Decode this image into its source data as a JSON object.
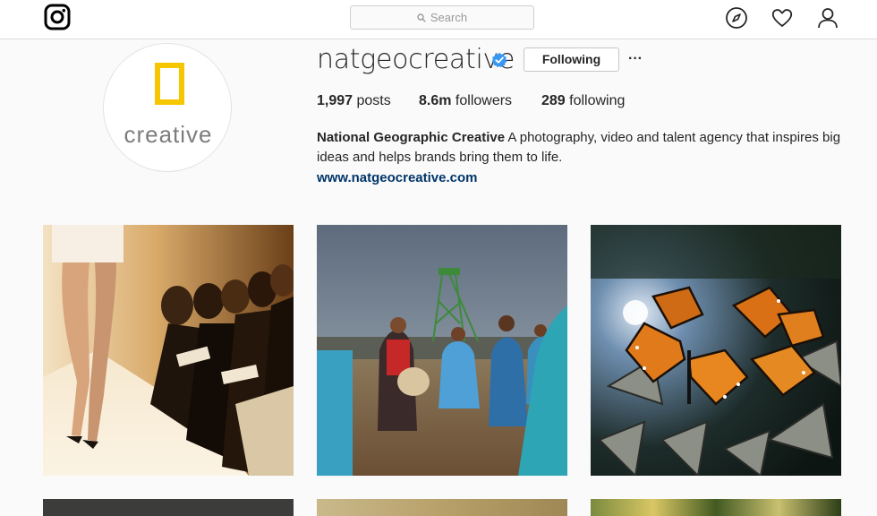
{
  "search": {
    "placeholder": "Search"
  },
  "profile": {
    "username": "natgeocreative",
    "verified": true,
    "follow_button": "Following",
    "more_label": "···",
    "avatar_text": "creative",
    "stats": {
      "posts_count": "1,997",
      "posts_label": " posts",
      "followers_count": "8.6m",
      "followers_label": " followers",
      "following_count": "289",
      "following_label": " following"
    },
    "bio_name": "National Geographic Creative",
    "bio_text": " A photography, video and talent agency that inspires big ideas and helps brands bring them to life.",
    "website": "www.natgeocreative.com"
  },
  "colors": {
    "brand_yellow": "#f6c600",
    "verified_blue": "#3897f0",
    "link_navy": "#003569"
  },
  "icons": [
    "instagram-logo-icon",
    "search-icon",
    "explore-compass-icon",
    "heart-icon",
    "profile-person-icon",
    "verified-badge-icon"
  ],
  "posts": [
    {
      "id": "post-1",
      "subject": "fashion runway"
    },
    {
      "id": "post-2",
      "subject": "dancers near mine tower"
    },
    {
      "id": "post-3",
      "subject": "monarch butterflies"
    },
    {
      "id": "post-4",
      "subject": ""
    },
    {
      "id": "post-5",
      "subject": ""
    },
    {
      "id": "post-6",
      "subject": ""
    }
  ]
}
